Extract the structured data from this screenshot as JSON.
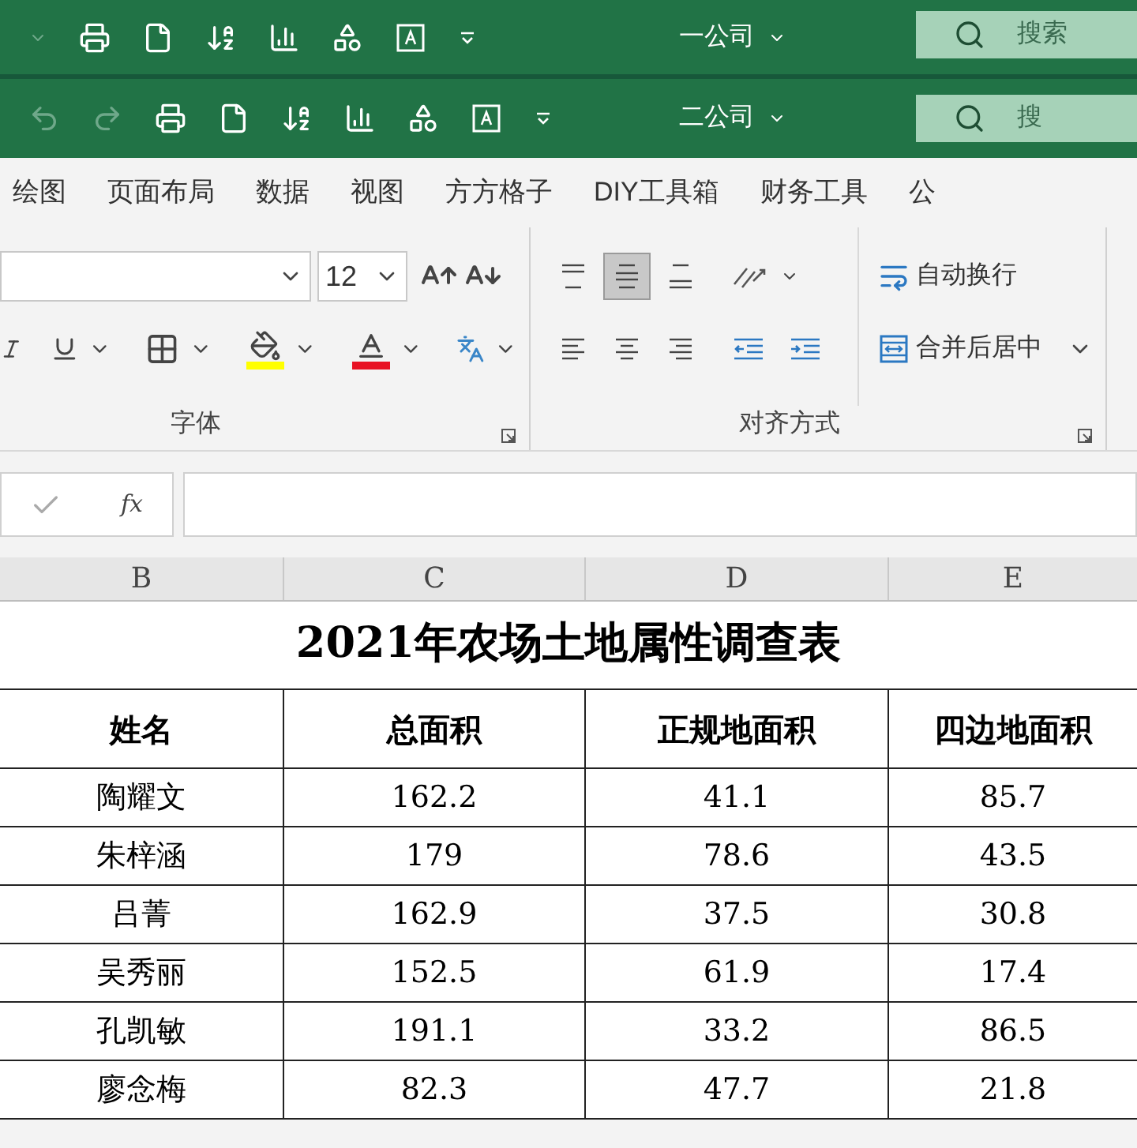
{
  "title_bars": [
    {
      "title": "一公司",
      "search": "搜索",
      "undo": false
    },
    {
      "title": "二公司",
      "search": "搜",
      "undo": true
    }
  ],
  "tabs": [
    "绘图",
    "页面布局",
    "数据",
    "视图",
    "方方格子",
    "DIY工具箱",
    "财务工具",
    "公"
  ],
  "font_group": {
    "size": "12",
    "label": "字体"
  },
  "alignment_group": {
    "vertical": [
      {
        "kind": "top",
        "selected": false
      },
      {
        "kind": "middle",
        "selected": true
      },
      {
        "kind": "bottom",
        "selected": false
      }
    ],
    "wrap": "自动换行",
    "merge": "合并后居中",
    "label": "对齐方式"
  },
  "formula_bar": {
    "fx": "fx"
  },
  "columns": [
    "B",
    "C",
    "D",
    "E"
  ],
  "sheet": {
    "title": "2021年农场土地属性调查表",
    "headers": [
      "姓名",
      "总面积",
      "正规地面积",
      "四边地面积"
    ],
    "rows": [
      [
        "陶耀文",
        "162.2",
        "41.1",
        "85.7"
      ],
      [
        "朱梓涵",
        "179",
        "78.6",
        "43.5"
      ],
      [
        "吕菁",
        "162.9",
        "37.5",
        "30.8"
      ],
      [
        "吴秀丽",
        "152.5",
        "61.9",
        "17.4"
      ],
      [
        "孔凯敏",
        "191.1",
        "33.2",
        "86.5"
      ],
      [
        "廖念梅",
        "82.3",
        "47.7",
        "21.8"
      ]
    ]
  }
}
